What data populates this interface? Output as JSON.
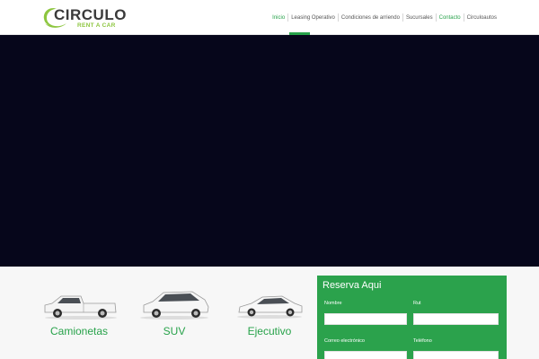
{
  "brand": {
    "name": "CIRCULO",
    "tagline": "RENT A CAR",
    "accent_color": "#8dc63f"
  },
  "nav": {
    "items": [
      {
        "label": "Inicio",
        "active": true
      },
      {
        "label": "Leasing Operativo",
        "active": false
      },
      {
        "label": "Condiciones de arriendo",
        "active": false
      },
      {
        "label": "Sucursales",
        "active": false
      },
      {
        "label": "Contacto",
        "active": false
      },
      {
        "label": "Circuloautos",
        "active": false
      }
    ],
    "active_color": "#27a24a"
  },
  "hero": {
    "background": "#06061b"
  },
  "categories": [
    {
      "label": "Camionetas",
      "icon": "pickup-truck-icon"
    },
    {
      "label": "SUV",
      "icon": "suv-icon"
    },
    {
      "label": "Ejecutivo",
      "icon": "sedan-icon"
    }
  ],
  "booking": {
    "title": "Reserva Aqui",
    "background": "#2ba24c",
    "fields": {
      "nombre": {
        "label": "Nombre",
        "value": "",
        "placeholder": ""
      },
      "rut": {
        "label": "Rut",
        "value": "",
        "placeholder": ""
      },
      "email": {
        "label": "Correo electrónico",
        "value": "",
        "placeholder": ""
      },
      "telefono": {
        "label": "Teléfono",
        "value": "",
        "placeholder": ""
      }
    }
  }
}
